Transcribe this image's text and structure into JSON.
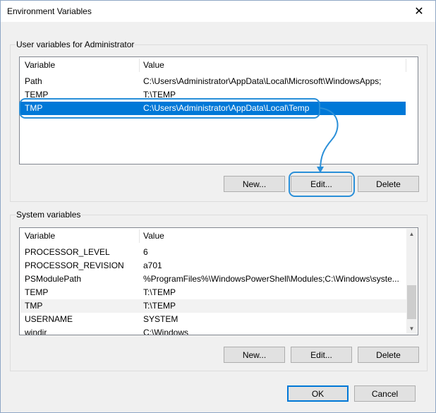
{
  "window": {
    "title": "Environment Variables",
    "close_glyph": "✕"
  },
  "user_vars": {
    "group_label": "User variables for Administrator",
    "columns": [
      "Variable",
      "Value"
    ],
    "rows": [
      {
        "variable": "Path",
        "value": "C:\\Users\\Administrator\\AppData\\Local\\Microsoft\\WindowsApps;"
      },
      {
        "variable": "TEMP",
        "value": "T:\\TEMP"
      },
      {
        "variable": "TMP",
        "value": "C:\\Users\\Administrator\\AppData\\Local\\Temp",
        "selected": true
      }
    ],
    "buttons": {
      "new": "New...",
      "edit": "Edit...",
      "delete": "Delete"
    }
  },
  "system_vars": {
    "group_label": "System variables",
    "columns": [
      "Variable",
      "Value"
    ],
    "rows": [
      {
        "variable": "PROCESSOR_LEVEL",
        "value": "6"
      },
      {
        "variable": "PROCESSOR_REVISION",
        "value": "a701"
      },
      {
        "variable": "PSModulePath",
        "value": "%ProgramFiles%\\WindowsPowerShell\\Modules;C:\\Windows\\syste..."
      },
      {
        "variable": "TEMP",
        "value": "T:\\TEMP"
      },
      {
        "variable": "TMP",
        "value": "T:\\TEMP",
        "hover": true
      },
      {
        "variable": "USERNAME",
        "value": "SYSTEM"
      },
      {
        "variable": "windir",
        "value": "C:\\Windows"
      }
    ],
    "buttons": {
      "new": "New...",
      "edit": "Edit...",
      "delete": "Delete"
    }
  },
  "footer": {
    "ok": "OK",
    "cancel": "Cancel"
  },
  "colors": {
    "selection": "#0078d7",
    "callout": "#2a8fd8",
    "default_button_border": "#0078d7"
  },
  "icons": {
    "close": "close-icon",
    "scroll_up": "chevron-up-icon",
    "scroll_down": "chevron-down-icon"
  }
}
